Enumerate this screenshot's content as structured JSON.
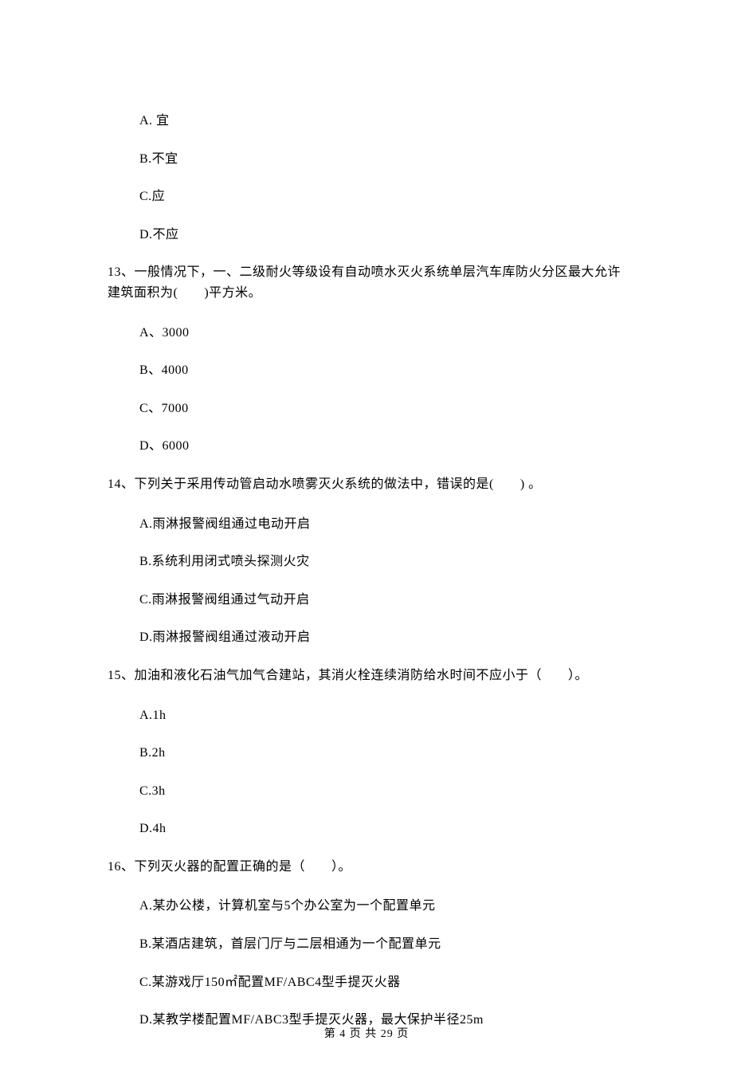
{
  "q12_options": {
    "A": "A. 宜",
    "B": "B.不宜",
    "C": "C.应",
    "D": "D.不应"
  },
  "q13": {
    "stem": "13、一般情况下，一、二级耐火等级设有自动喷水灭火系统单层汽车库防火分区最大允许建筑面积为(　　)平方米。",
    "A": "A、3000",
    "B": "B、4000",
    "C": "C、7000",
    "D": "D、6000"
  },
  "q14": {
    "stem": "14、下列关于采用传动管启动水喷雾灭火系统的做法中，错误的是(　　) 。",
    "A": "A.雨淋报警阀组通过电动开启",
    "B": "B.系统利用闭式喷头探测火灾",
    "C": "C.雨淋报警阀组通过气动开启",
    "D": "D.雨淋报警阀组通过液动开启"
  },
  "q15": {
    "stem": "15、加油和液化石油气加气合建站，其消火栓连续消防给水时间不应小于（　　）。",
    "A": "A.1h",
    "B": "B.2h",
    "C": "C.3h",
    "D": "D.4h"
  },
  "q16": {
    "stem": "16、下列灭火器的配置正确的是（　　）。",
    "A": "A.某办公楼，计算机室与5个办公室为一个配置单元",
    "B": "B.某酒店建筑，首层门厅与二层相通为一个配置单元",
    "C": "C.某游戏厅150㎡配置MF/ABC4型手提灭火器",
    "D": "D.某教学楼配置MF/ABC3型手提灭火器，最大保护半径25m"
  },
  "footer": "第 4 页 共 29 页"
}
